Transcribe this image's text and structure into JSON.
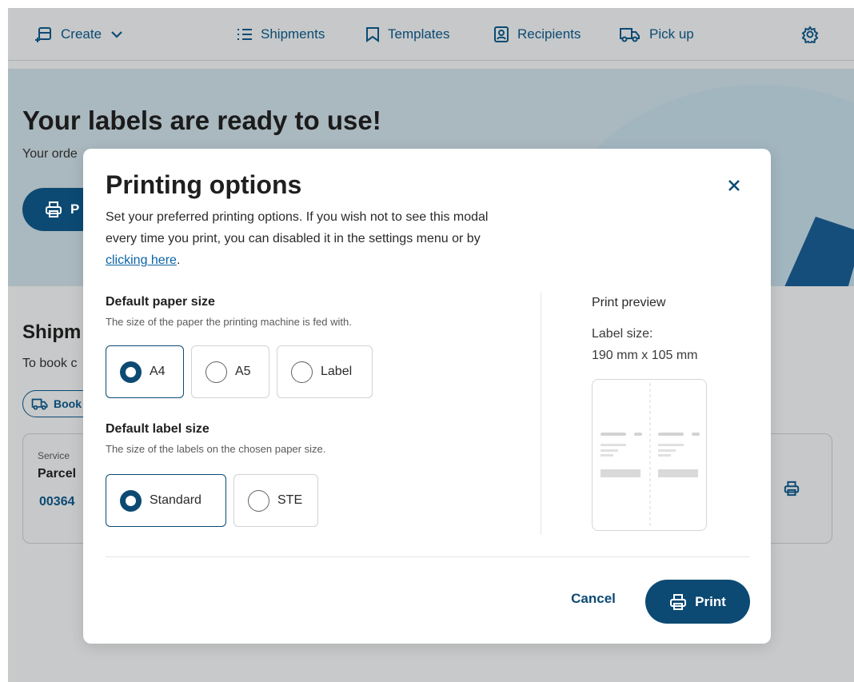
{
  "nav": {
    "create_label": "Create",
    "shipments_label": "Shipments",
    "templates_label": "Templates",
    "recipients_label": "Recipients",
    "pickup_label": "Pick up"
  },
  "hero": {
    "title": "Your labels are ready to use!",
    "subtitle": "Your orde",
    "button_label": "P"
  },
  "shipments": {
    "title": "Shipm",
    "subtitle": "To book c",
    "book_label": "Book",
    "card": {
      "service_label": "Service",
      "service_value": "Parcel",
      "number": "00364"
    }
  },
  "modal": {
    "title": "Printing options",
    "description": "Set your preferred printing options. If you wish not to see this modal every time you print, you can disabled it in the settings menu or by ",
    "description_link": "clicking here",
    "description_end": ".",
    "paper_size": {
      "title": "Default paper size",
      "subtitle": "The size of the paper the printing machine is fed with.",
      "options": [
        "A4",
        "A5",
        "Label"
      ],
      "selected": "A4"
    },
    "label_size": {
      "title": "Default label size",
      "subtitle": "The size of the labels on the chosen paper size.",
      "options": [
        "Standard",
        "STE"
      ],
      "selected": "Standard"
    },
    "preview": {
      "title": "Print preview",
      "label_size_caption": "Label size:",
      "label_size_value": "190 mm x 105 mm"
    },
    "cancel_label": "Cancel",
    "print_label": "Print"
  },
  "colors": {
    "accent": "#0c4a73",
    "link": "#0c64a6"
  }
}
